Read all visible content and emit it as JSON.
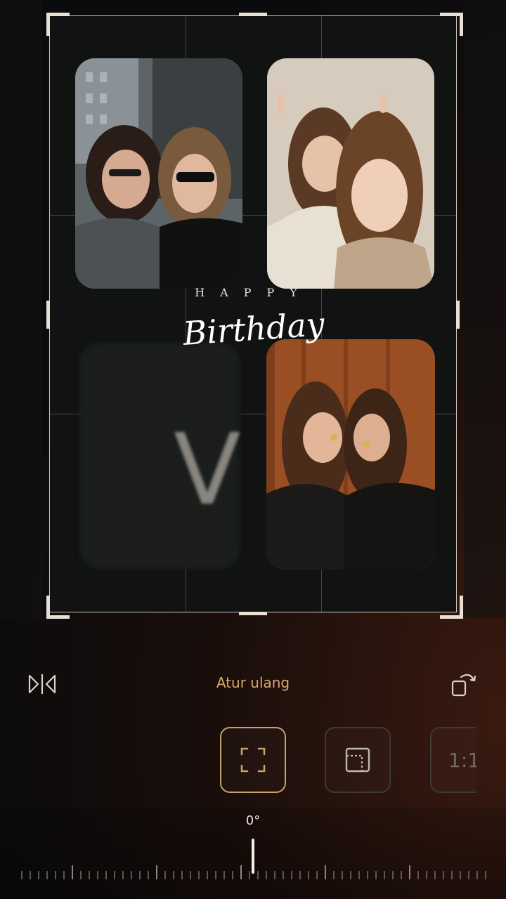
{
  "editor": {
    "canvas": {
      "happy_text": "HAPPY",
      "birthday_text": "Birthday",
      "placeholder_letter": "V"
    },
    "toolbar": {
      "flip_icon": "flip-horizontal-icon",
      "reset_label": "Atur ulang",
      "rotate_icon": "rotate-icon"
    },
    "aspect_options": [
      {
        "name": "free-crop-icon",
        "selected": true
      },
      {
        "name": "original-ratio-icon",
        "selected": false
      },
      {
        "name": "ratio-1-1",
        "label": "1:1",
        "selected": false
      }
    ],
    "rotation": {
      "angle_label": "0°",
      "value_degrees": 0
    },
    "colors": {
      "accent": "#c9a06a",
      "frame": "#cfc6b8",
      "background": "#0c0c0e"
    }
  }
}
